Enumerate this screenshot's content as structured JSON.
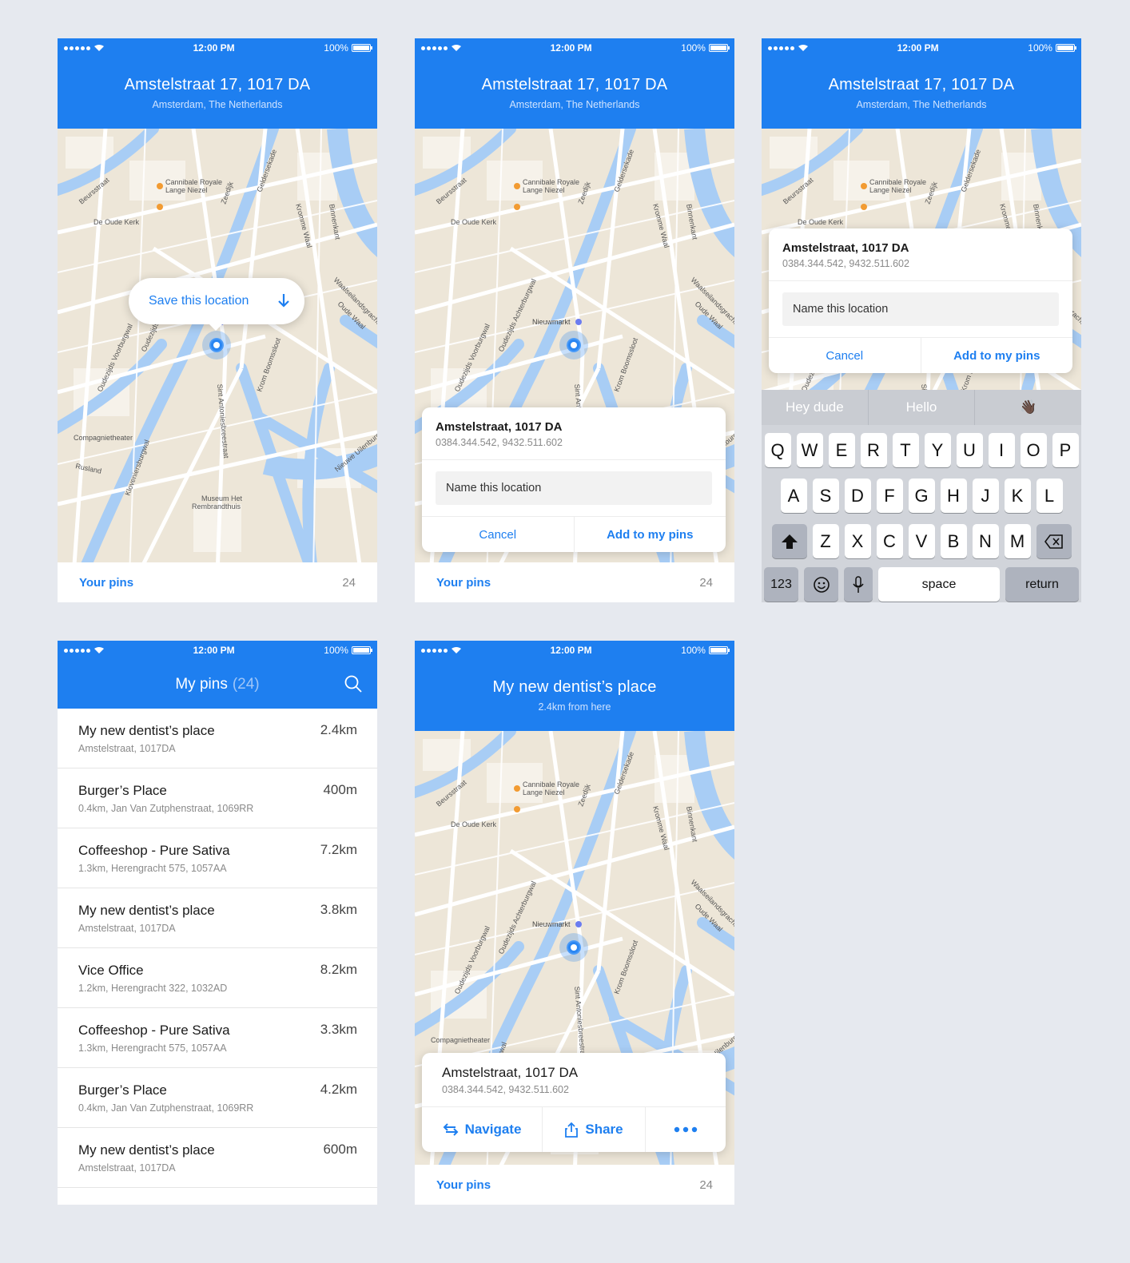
{
  "status": {
    "time": "12:00 PM",
    "battery": "100%"
  },
  "location": {
    "title": "Amstelstraat 17, 1017 DA",
    "subtitle": "Amsterdam, The Netherlands",
    "card_address": "Amstelstraat, 1017 DA",
    "coords": "0384.344.542, 9432.511.602"
  },
  "save_popup": {
    "label": "Save this location"
  },
  "name_input": {
    "placeholder": "Name this location"
  },
  "actions": {
    "cancel": "Cancel",
    "add": "Add to my pins"
  },
  "pins_bar": {
    "label": "Your pins",
    "count": "24"
  },
  "map_labels": {
    "cannibale": "Cannibale Royale",
    "lange": "Lange Niezel",
    "oudekerk": "De Oude Kerk",
    "nieuwmarkt": "Nieuwmarkt",
    "compagnie": "Compagnietheater",
    "rusland": "Rusland",
    "museum1": "Museum Het",
    "museum2": "Rembrandthuis",
    "beursstraat": "Beursstraat",
    "zeedijk": "Zeedijk",
    "gelderse": "Geldersekade",
    "kromme": "Kromme Waal",
    "binnenkant": "Binnenkant",
    "oudezijds": "Oudezijds Achterburgwal",
    "voorburgwal": "Oudezijds Voorburgwal",
    "waals": "Waalseilandsgracht",
    "oudewaal": "Oude Waal",
    "sintanton": "Sint Antoniesbreestraat",
    "krom": "Krom Boomssloot",
    "kloveniers": "Kloveniersburgwal",
    "nieuweuilen": "Nieuwe Uilenburgerstraat"
  },
  "keyboard": {
    "suggestions": [
      "Hey dude",
      "Hello",
      "👋🏿"
    ],
    "row1": [
      "Q",
      "W",
      "E",
      "R",
      "T",
      "Y",
      "U",
      "I",
      "O",
      "P"
    ],
    "row2": [
      "A",
      "S",
      "D",
      "F",
      "G",
      "H",
      "J",
      "K",
      "L"
    ],
    "row3": [
      "Z",
      "X",
      "C",
      "V",
      "B",
      "N",
      "M"
    ],
    "key_123": "123",
    "key_space": "space",
    "key_return": "return"
  },
  "pins_list": {
    "title": "My pins",
    "count": "(24)",
    "items": [
      {
        "name": "My new dentist’s place",
        "sub": "Amstelstraat, 1017DA",
        "dist": "2.4km"
      },
      {
        "name": "Burger’s Place",
        "sub": "0.4km, Jan Van Zutphenstraat, 1069RR",
        "dist": "400m"
      },
      {
        "name": "Coffeeshop - Pure Sativa",
        "sub": "1.3km, Herengracht 575, 1057AA",
        "dist": "7.2km"
      },
      {
        "name": "My new dentist’s place",
        "sub": "Amstelstraat, 1017DA",
        "dist": "3.8km"
      },
      {
        "name": "Vice Office",
        "sub": "1.2km, Herengracht 322, 1032AD",
        "dist": "8.2km"
      },
      {
        "name": "Coffeeshop - Pure Sativa",
        "sub": "1.3km, Herengracht 575, 1057AA",
        "dist": "3.3km"
      },
      {
        "name": "Burger’s Place",
        "sub": "0.4km, Jan Van Zutphenstraat, 1069RR",
        "dist": "4.2km"
      },
      {
        "name": "My new dentist’s place",
        "sub": "Amstelstraat, 1017DA",
        "dist": "600m"
      }
    ]
  },
  "detail": {
    "title": "My new dentist’s place",
    "subtitle": "2.4km from here",
    "address": "Amstelstraat, 1017 DA",
    "navigate": "Navigate",
    "share": "Share"
  }
}
